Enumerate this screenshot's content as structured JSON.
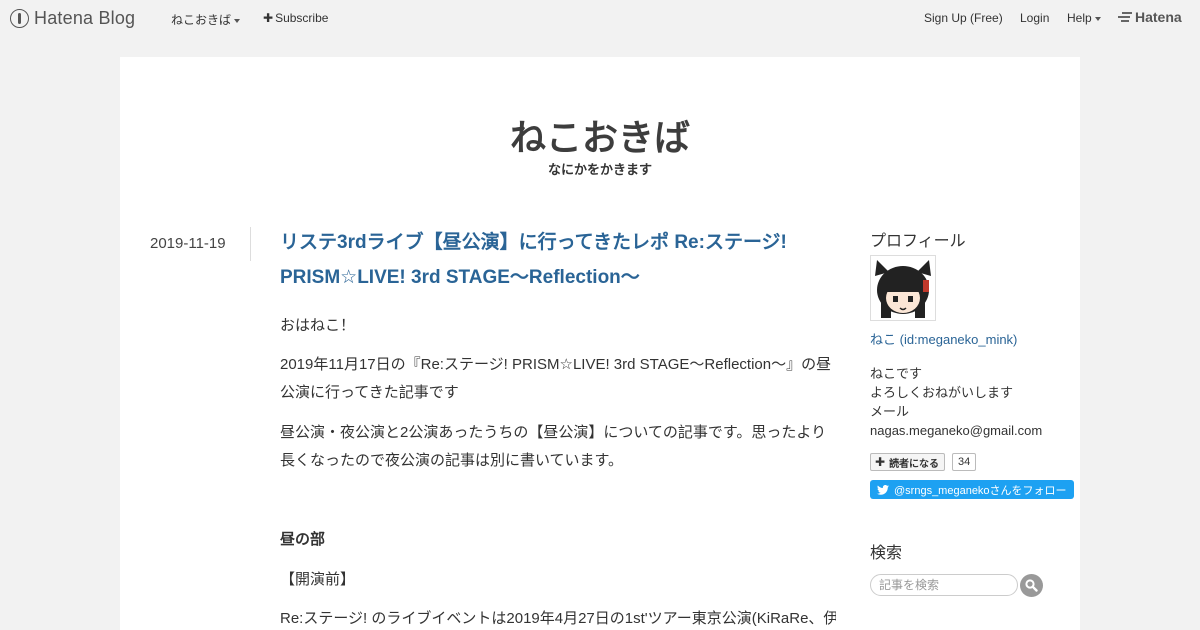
{
  "global_header": {
    "logo_text": "Hatena Blog",
    "blog_menu": "ねこおきば",
    "subscribe": "Subscribe",
    "signup": "Sign Up (Free)",
    "login": "Login",
    "help": "Help",
    "brand": "Hatena"
  },
  "blog": {
    "title": "ねこおきば",
    "description": "なにかをかきます"
  },
  "entry": {
    "date": "2019-11-19",
    "title": "リステ3rdライブ【昼公演】に行ってきたレポ Re:ステージ! PRISM☆LIVE! 3rd STAGE～Reflection～",
    "paragraphs": [
      "おはねこ！",
      "2019年11月17日の『Re:ステージ! PRISM☆LIVE! 3rd STAGE～Reflection～』の昼公演に行ってきた記事です",
      "昼公演・夜公演と2公演あったうちの【昼公演】についての記事です。思ったより長くなったので夜公演の記事は別に書いています。",
      "昼の部",
      "【開演前】",
      "Re:ステージ! のライブイベントは2019年4月27日の1st'ツアー東京公演(KiRaRe、伊"
    ]
  },
  "sidebar": {
    "profile_heading": "プロフィール",
    "profile_link": "ねこ (id:meganeko_mink)",
    "bio": [
      "ねこです",
      "よろしくおねがいします",
      "メール",
      "nagas.meganeko@gmail.com"
    ],
    "reader_button": "読者になる",
    "reader_count": "34",
    "twitter_follow": "@srngs_meganekoさんをフォロー",
    "search_heading": "検索",
    "search_placeholder": "記事を検索"
  }
}
